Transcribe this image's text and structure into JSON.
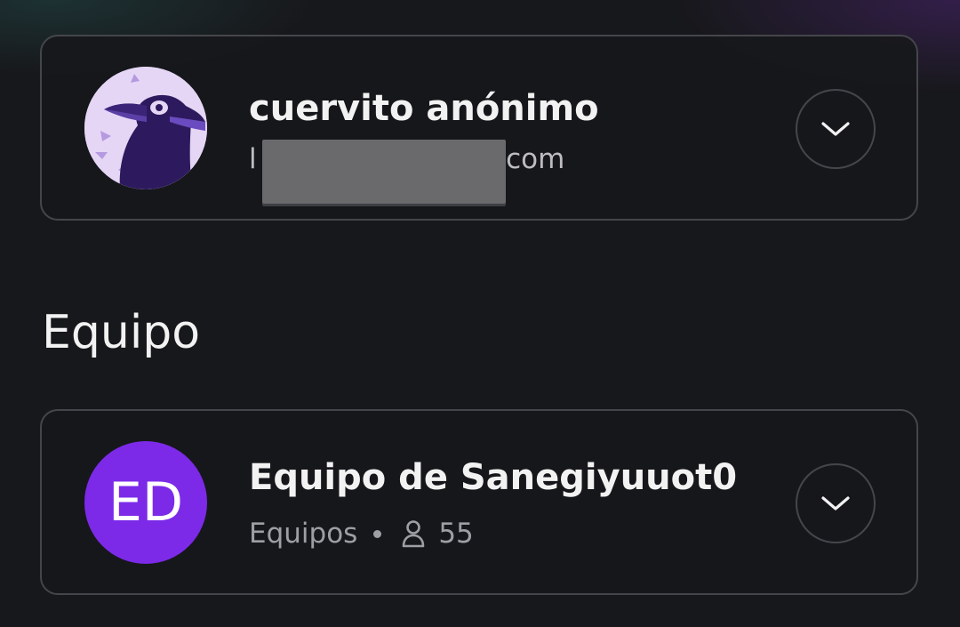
{
  "account": {
    "name": "cuervito anónimo",
    "email_visible_start": "l",
    "email_visible_end": "l.com",
    "avatar_icon": "crow-avatar-icon",
    "expand_icon": "chevron-down-icon"
  },
  "section": {
    "heading": "Equipo"
  },
  "team": {
    "name": "Equipo de Sanegiyuuot0",
    "initials": "ED",
    "type_label": "Equipos",
    "member_count": "55",
    "member_icon": "person-icon",
    "expand_icon": "chevron-down-icon"
  },
  "colors": {
    "background": "#17181b",
    "card_border": "#45464b",
    "team_avatar": "#7c2ae8",
    "crow_avatar_bg": "#e6d6f5",
    "crow": "#2d1a5e",
    "redaction": "#6a6a6d"
  }
}
